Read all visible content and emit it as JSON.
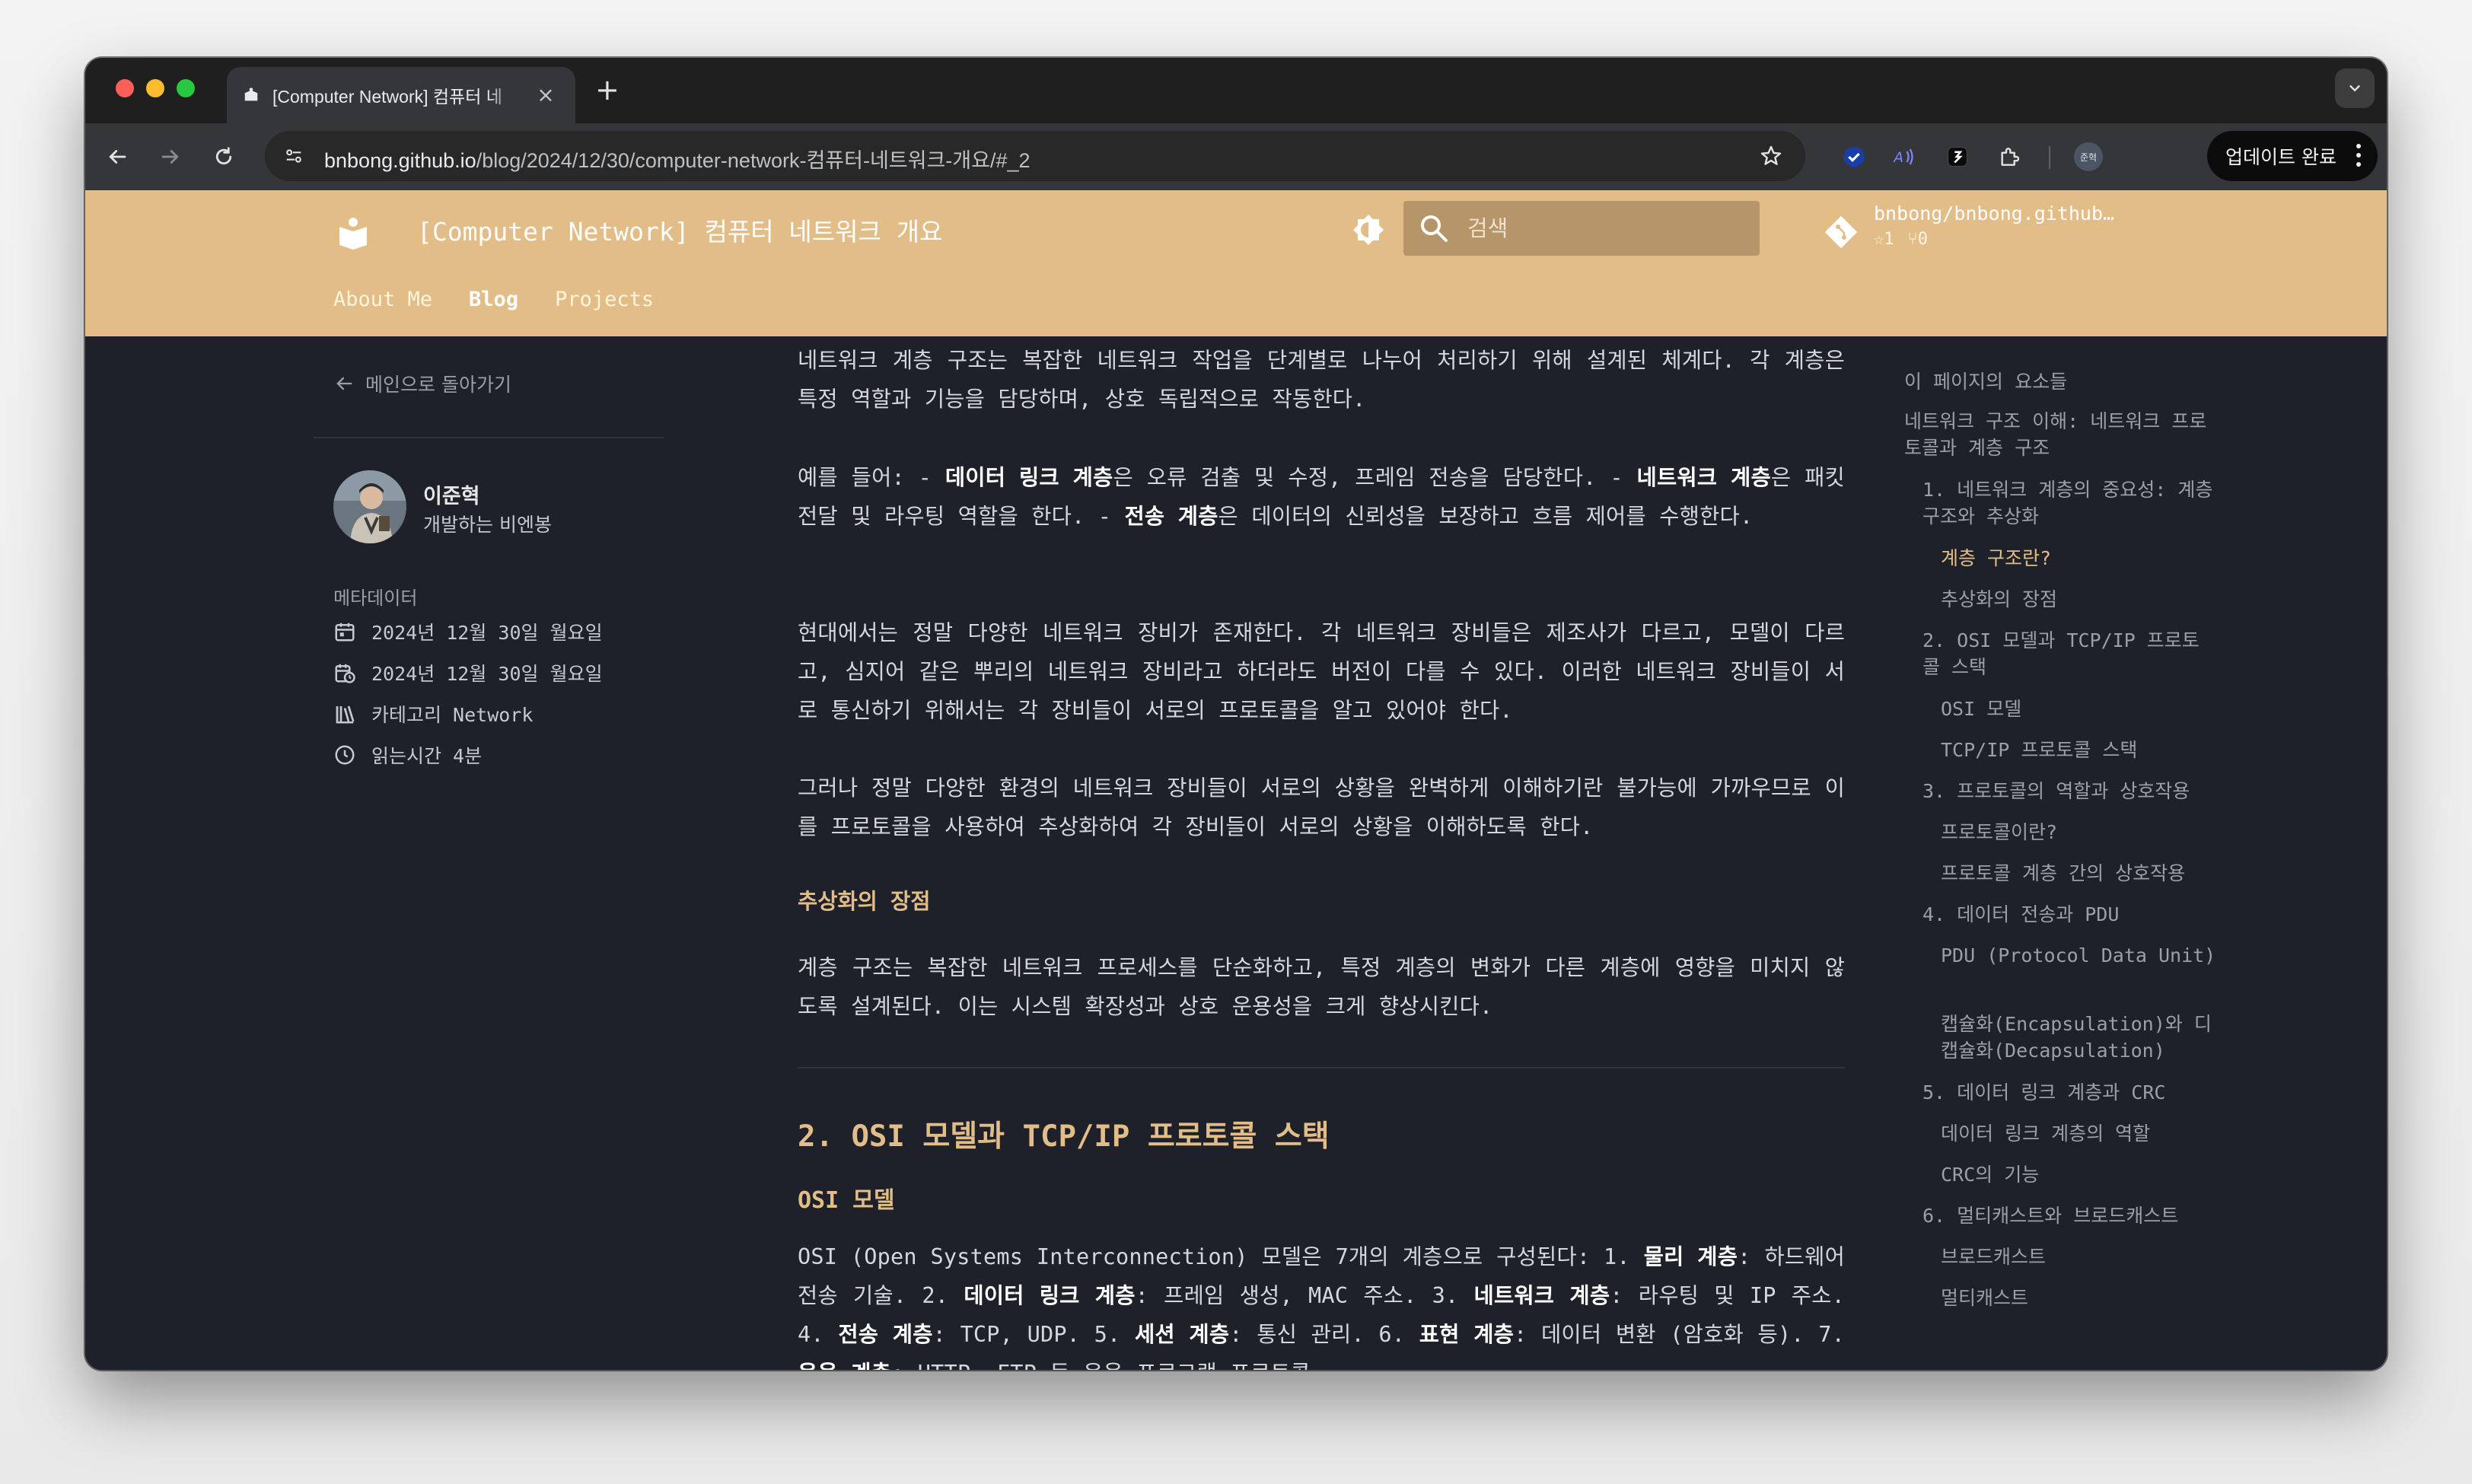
{
  "browser": {
    "tab_title": "[Computer Network] 컴퓨터 네",
    "url_host": "bnbong.github.io",
    "url_path": "/blog/2024/12/30/computer-network-컴퓨터-네트워크-개요/#_2",
    "profile_label": "준혁",
    "update_button": "업데이트 완료"
  },
  "header": {
    "site_title": "[Computer Network] 컴퓨터 네트워크 개요",
    "search_placeholder": "검색",
    "repo_name": "bnbong/bnbong.github…",
    "repo_stars": "1",
    "repo_forks": "0",
    "nav": [
      {
        "label": "About Me"
      },
      {
        "label": "Blog"
      },
      {
        "label": "Projects"
      }
    ]
  },
  "sidebar": {
    "back_label": "메인으로 돌아가기",
    "author_name": "이준혁",
    "author_desc": "개발하는 비엔봉",
    "meta_title": "메타데이터",
    "created": "2024년 12월 30일 월요일",
    "updated": "2024년 12월 30일 월요일",
    "category": "카테고리 Network",
    "reading_time": "읽는시간 4분"
  },
  "article": {
    "p1": "네트워크 계층 구조는 복잡한 네트워크 작업을 단계별로 나누어 처리하기 위해 설계된 체계다. 각 계층은 특정 역할과 기능을 담당하며, 상호 독립적으로 작동한다.",
    "p2_a": "예를 들어: - ",
    "p2_b": "데이터 링크 계층",
    "p2_c": "은 오류 검출 및 수정, 프레임 전송을 담당한다. - ",
    "p2_d": "네트워크 계층",
    "p2_e": "은 패킷 전달 및 라우팅 역할을 한다. - ",
    "p2_f": "전송 계층",
    "p2_g": "은 데이터의 신뢰성을 보장하고 흐름 제어를 수행한다.",
    "p3": "현대에서는 정말 다양한 네트워크 장비가 존재한다. 각 네트워크 장비들은 제조사가 다르고, 모델이 다르고, 심지어 같은 뿌리의 네트워크 장비라고 하더라도 버전이 다를 수 있다. 이러한 네트워크 장비들이 서로 통신하기 위해서는 각 장비들이 서로의 프로토콜을 알고 있어야 한다.",
    "p4": "그러나 정말 다양한 환경의 네트워크 장비들이 서로의 상황을 완벽하게 이해하기란 불가능에 가까우므로 이를 프로토콜을 사용하여 추상화하여 각 장비들이 서로의 상황을 이해하도록 한다.",
    "h_advantage": "추상화의 장점",
    "p5": "계층 구조는 복잡한 네트워크 프로세스를 단순화하고, 특정 계층의 변화가 다른 계층에 영향을 미치지 않도록 설계된다. 이는 시스템 확장성과 상호 운용성을 크게 향상시킨다.",
    "h2": "2. OSI 모델과 TCP/IP 프로토콜 스택",
    "h3": "OSI 모델",
    "p6_a": "OSI (Open Systems Interconnection) 모델은 7개의 계층으로 구성된다: 1. ",
    "p6_l1": "물리 계층",
    "p6_t1": ": 하드웨어 전송 기술. 2. ",
    "p6_l2": "데이터 링크 계층",
    "p6_t2": ": 프레임 생성, MAC 주소. 3. ",
    "p6_l3": "네트워크 계층",
    "p6_t3": ": 라우팅 및 IP 주소. 4. ",
    "p6_l4": "전송 계층",
    "p6_t4": ": TCP, UDP. 5. ",
    "p6_l5": "세션 계층",
    "p6_t5": ": 통신 관리. 6. ",
    "p6_l6": "표현 계층",
    "p6_t6": ": 데이터 변환 (암호화 등). 7. ",
    "p6_l7": "응용 계층",
    "p6_t7": ": HTTP, FTP 등 응용 프로그램 프로토콜."
  },
  "toc": {
    "title": "이 페이지의 요소들",
    "items": [
      {
        "label": "네트워크 구조 이해: 네트워크 프로토콜과 계층 구조"
      },
      {
        "label": "1. 네트워크 계층의 중요성: 계층 구조와 추상화"
      },
      {
        "label": "계층 구조란?"
      },
      {
        "label": "추상화의 장점"
      },
      {
        "label": "2. OSI 모델과 TCP/IP 프로토콜 스택"
      },
      {
        "label": "OSI 모델"
      },
      {
        "label": "TCP/IP 프로토콜 스택"
      },
      {
        "label": "3. 프로토콜의 역할과 상호작용"
      },
      {
        "label": "프로토콜이란?"
      },
      {
        "label": "프로토콜 계층 간의 상호작용"
      },
      {
        "label": "4. 데이터 전송과 PDU"
      },
      {
        "label": "PDU (Protocol Data Unit)"
      },
      {
        "label": "캡슐화(Encapsulation)와 디캡슐화(Decapsulation)"
      },
      {
        "label": "5. 데이터 링크 계층과 CRC"
      },
      {
        "label": "데이터 링크 계층의 역할"
      },
      {
        "label": "CRC의 기능"
      },
      {
        "label": "6. 멀티캐스트와 브로드캐스트"
      },
      {
        "label": "브로드캐스트"
      },
      {
        "label": "멀티캐스트"
      }
    ]
  },
  "colors": {
    "accent": "#e2bd87",
    "page_bg": "#1e2129",
    "header_bg": "#e2bd87"
  }
}
